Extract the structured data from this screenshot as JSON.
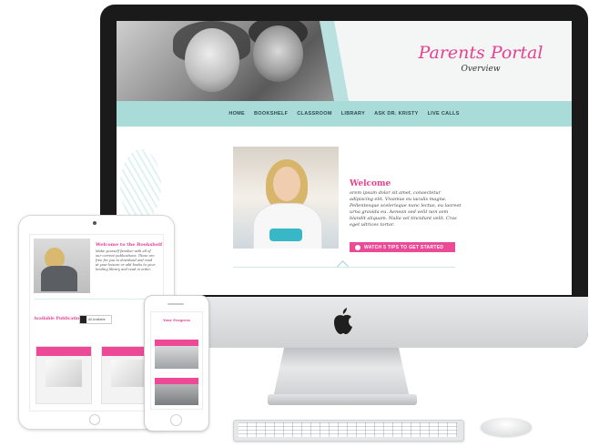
{
  "portal": {
    "title": "Parents Portal",
    "subtitle": "Overview"
  },
  "nav": {
    "items": [
      "HOME",
      "BOOKSHELF",
      "CLASSROOM",
      "LIBRARY",
      "ASK DR. KRISTY",
      "LIVE CALLS"
    ]
  },
  "welcome": {
    "heading": "Welcome",
    "text": "orem ipsum dolor sit amet, consectetur adipiscing elit. Vivamus eu iaculis magna. Pellentesque scelerisque nunc lectus, eu laoreet urna gravida eu. Aenean sed velit non sem blandit aliquam. Nulla vel tincidunt velit. Cras eget ultrices tortor.",
    "cta_label": "WATCH 5 TIPS TO GET STARTED"
  },
  "ipad": {
    "heading": "Welcome to the Bookshelf",
    "text": "Make yourself familiar with all of our current publications. These are free for you to download and read at your leisure or add books to your lending library and read in order.",
    "available": "Available Publications",
    "filter": "All Available"
  },
  "iphone": {
    "heading": "Your Progress"
  },
  "colors": {
    "accent_pink": "#e83f8f",
    "nav_teal": "#a9dcd9"
  }
}
